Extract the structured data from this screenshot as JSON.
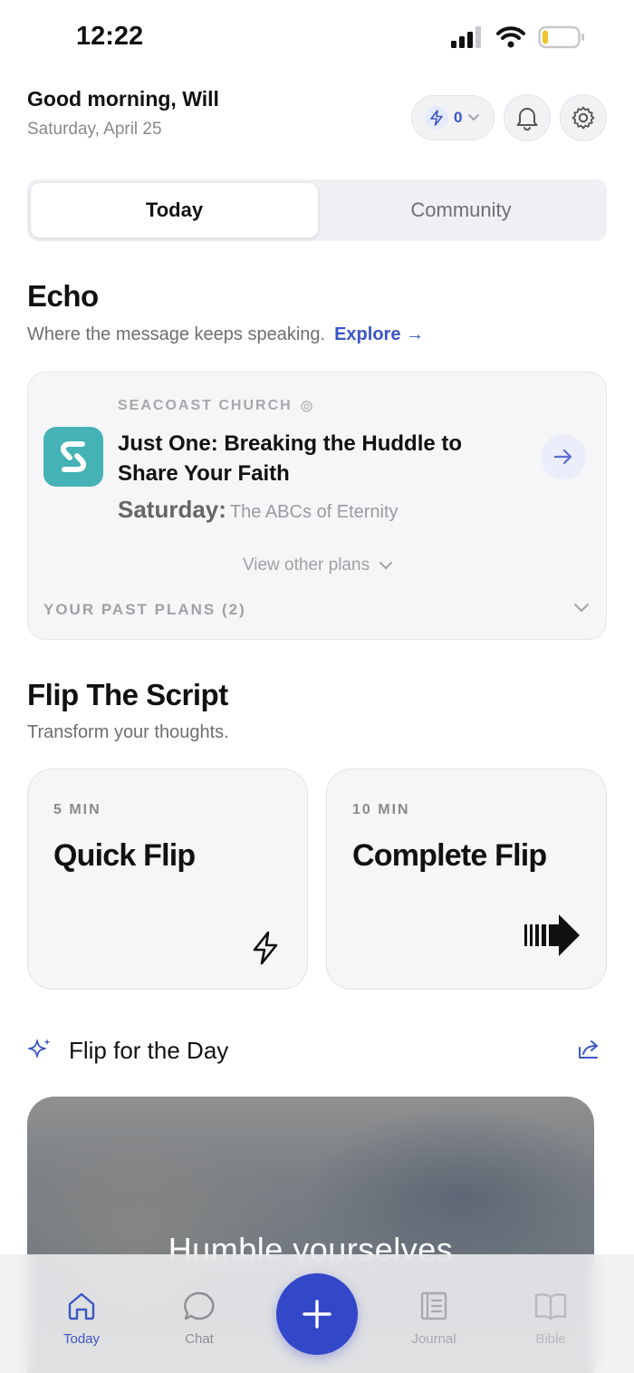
{
  "status_bar": {
    "time": "12:22"
  },
  "header": {
    "greeting": "Good morning, Will",
    "date": "Saturday, April 25",
    "streak_count": "0"
  },
  "segmented": {
    "tabs": [
      {
        "label": "Today",
        "active": true
      },
      {
        "label": "Community",
        "active": false
      }
    ]
  },
  "echo": {
    "title": "Echo",
    "subtitle": "Where the message keeps speaking.",
    "explore": "Explore →",
    "card": {
      "church": "SEACOAST CHURCH",
      "plan_title": "Just One: Breaking the Huddle to Share Your Faith",
      "day_label": "Saturday:",
      "day_topic": "The ABCs of Eternity",
      "view_other": "View other plans",
      "past_plans": "YOUR PAST PLANS (2)"
    }
  },
  "flip_script": {
    "title": "Flip The Script",
    "subtitle": "Transform your thoughts.",
    "cards": [
      {
        "duration": "5 MIN",
        "name": "Quick Flip",
        "icon": "lightning-icon"
      },
      {
        "duration": "10 MIN",
        "name": "Complete Flip",
        "icon": "arrow-right-bold-icon"
      }
    ]
  },
  "flip_for_day": {
    "label": "Flip for the Day",
    "verse_partial": "Humble yourselves"
  },
  "tab_bar": {
    "items": [
      {
        "label": "Today",
        "icon": "home-icon",
        "active": true
      },
      {
        "label": "Chat",
        "icon": "chat-icon",
        "active": false
      },
      {
        "label": "Journal",
        "icon": "journal-icon",
        "active": false
      },
      {
        "label": "Bible",
        "icon": "bible-icon",
        "active": false
      }
    ],
    "fab_icon": "plus-icon"
  },
  "colors": {
    "accent": "#3b56c4",
    "fab": "#3347c9",
    "church_logo": "#45b2b5"
  }
}
